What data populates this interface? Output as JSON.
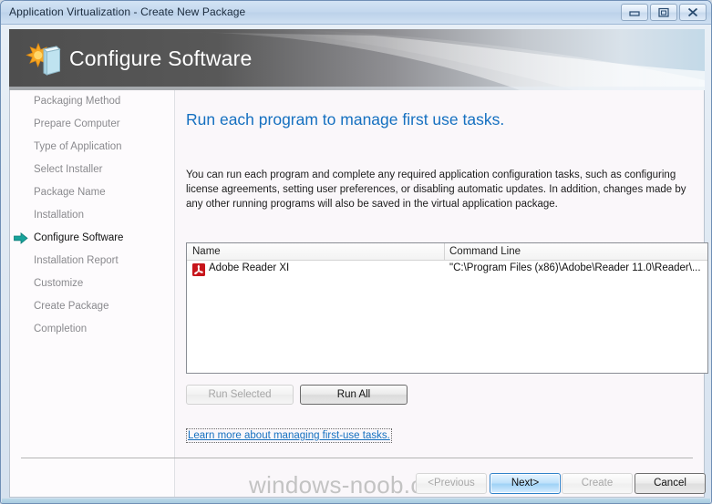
{
  "window": {
    "title": "Application Virtualization - Create New Package",
    "controls": [
      {
        "name": "minimize",
        "label": "Minimize"
      },
      {
        "name": "maximize",
        "label": "Maximize"
      },
      {
        "name": "close",
        "label": "Close"
      }
    ]
  },
  "banner": {
    "title": "Configure Software",
    "icon": "package-star-icon"
  },
  "sidebar": {
    "items": [
      {
        "label": "Packaging Method",
        "active": false
      },
      {
        "label": "Prepare Computer",
        "active": false
      },
      {
        "label": "Type of Application",
        "active": false
      },
      {
        "label": "Select Installer",
        "active": false
      },
      {
        "label": "Package Name",
        "active": false
      },
      {
        "label": "Installation",
        "active": false
      },
      {
        "label": "Configure Software",
        "active": true
      },
      {
        "label": "Installation Report",
        "active": false
      },
      {
        "label": "Customize",
        "active": false
      },
      {
        "label": "Create Package",
        "active": false
      },
      {
        "label": "Completion",
        "active": false
      }
    ]
  },
  "content": {
    "headline": "Run each program to manage first use tasks.",
    "body": "You can run each program and complete any required application configuration tasks, such as configuring license agreements, setting user preferences, or disabling automatic updates. In addition, changes made by any other running programs will also be saved in the virtual application package.",
    "table": {
      "columns": [
        "Name",
        "Command Line"
      ],
      "rows": [
        {
          "icon": "adobe-acrobat-icon",
          "name": "Adobe Reader XI",
          "command_line": "\"C:\\Program Files (x86)\\Adobe\\Reader 11.0\\Reader\\..."
        }
      ]
    },
    "run_selected_label": "Run Selected",
    "run_all_label": "Run All",
    "learn_more_label": "Learn more about managing first-use tasks."
  },
  "footer": {
    "watermark": "windows-noob.com",
    "previous_label": "<Previous",
    "next_label": "Next>",
    "create_label": "Create",
    "cancel_label": "Cancel"
  },
  "colors": {
    "accent_link": "#1570c0",
    "headline": "#1570c0",
    "active_arrow": "#1a9b9b",
    "pdf_red": "#c7151b",
    "default_button_border": "#2f82c9"
  }
}
